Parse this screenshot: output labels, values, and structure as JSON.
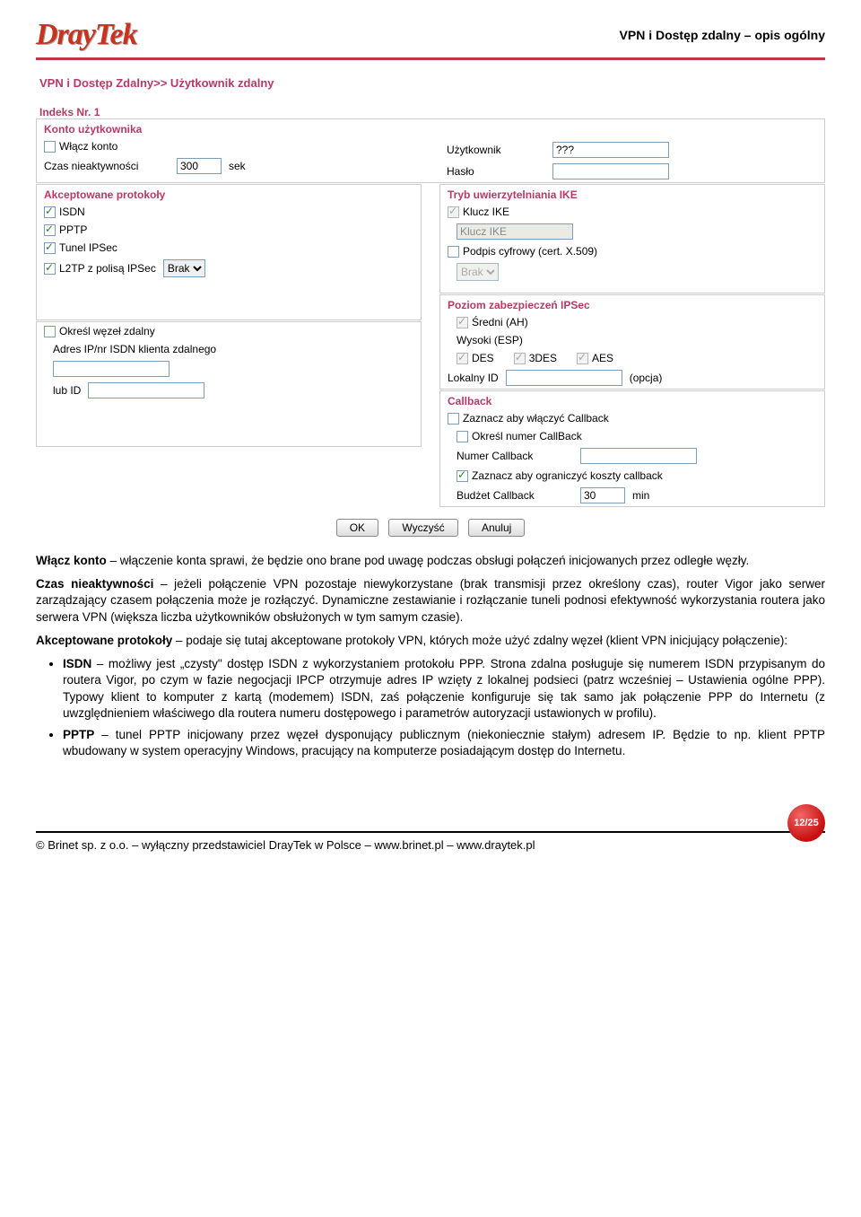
{
  "header": {
    "title": "VPN i Dostęp zdalny – opis ogólny"
  },
  "breadcrumb": "VPN i Dostęp Zdalny>> Użytkownik zdalny",
  "index_label": "Indeks Nr. 1",
  "account": {
    "title": "Konto użytkownika",
    "enable": "Włącz konto",
    "idle_label": "Czas nieaktywności",
    "idle_value": "300",
    "idle_unit": "sek",
    "user_label": "Użytkownik",
    "user_value": "???",
    "pass_label": "Hasło",
    "pass_value": ""
  },
  "protocols": {
    "title": "Akceptowane protokoły",
    "isdn": "ISDN",
    "pptp": "PPTP",
    "ipsec": "Tunel IPSec",
    "l2tp": "L2TP z polisą IPSec",
    "l2tp_select": "Brak",
    "remote_node": "Określ węzeł zdalny",
    "ip_label": "Adres IP/nr ISDN klienta zdalnego",
    "ip_value": "",
    "or_id_label": "lub ID",
    "or_id_value": ""
  },
  "ike": {
    "title": "Tryb uwierzytelniania IKE",
    "key": "Klucz IKE",
    "key_field": "Klucz IKE",
    "cert": "Podpis cyfrowy (cert. X.509)",
    "cert_select": "Brak"
  },
  "ipsec_level": {
    "title": "Poziom zabezpieczeń IPSec",
    "medium": "Średni (AH)",
    "high": "Wysoki (ESP)",
    "des": "DES",
    "tdes": "3DES",
    "aes": "AES",
    "localid": "Lokalny ID",
    "localid_val": "",
    "opt": "(opcja)"
  },
  "callback": {
    "title": "Callback",
    "enable": "Zaznacz aby włączyć Callback",
    "specify": "Określ numer CallBack",
    "num_label": "Numer Callback",
    "num_value": "",
    "limit": "Zaznacz aby ograniczyć koszty callback",
    "budget_label": "Budżet Callback",
    "budget_value": "30",
    "budget_unit": "min"
  },
  "buttons": {
    "ok": "OK",
    "clear": "Wyczyść",
    "cancel": "Anuluj"
  },
  "text": {
    "p1a": "Włącz konto",
    "p1b": " – włączenie konta sprawi, że będzie ono brane pod uwagę podczas obsługi połączeń inicjowanych przez odległe węzły.",
    "p2a": "Czas nieaktywności",
    "p2b": " – jeżeli połączenie VPN pozostaje niewykorzystane (brak transmisji przez określony czas), router Vigor jako serwer zarządzający czasem połączenia może je rozłączyć. Dynamiczne zestawianie i rozłączanie tuneli podnosi efektywność wykorzystania routera jako serwera VPN (większa liczba użytkowników obsłużonych w tym samym czasie).",
    "p3a": "Akceptowane protokoły",
    "p3b": " – podaje się tutaj akceptowane protokoły VPN, których może użyć zdalny węzeł (klient VPN inicjujący połączenie):",
    "li1a": "ISDN",
    "li1b": " – możliwy jest „czysty\" dostęp ISDN z wykorzystaniem protokołu PPP. Strona zdalna posługuje się numerem ISDN przypisanym do routera Vigor, po czym w fazie negocjacji IPCP otrzymuje adres IP wzięty z lokalnej podsieci (patrz wcześniej – Ustawienia ogólne PPP). Typowy klient to komputer z kartą (modemem) ISDN, zaś połączenie konfiguruje się tak samo jak połączenie PPP do Internetu (z uwzględnieniem właściwego dla routera numeru dostępowego i parametrów autoryzacji ustawionych w profilu).",
    "li2a": "PPTP",
    "li2b": " – tunel PPTP inicjowany przez węzeł dysponujący publicznym (niekoniecznie stałym) adresem IP. Będzie to np. klient PPTP wbudowany w system operacyjny Windows, pracujący na komputerze posiadającym dostęp do Internetu."
  },
  "footer": {
    "left": "© Brinet sp. z o.o. – wyłączny przedstawiciel DrayTek w Polsce – www.brinet.pl – www.draytek.pl",
    "page": "12/25"
  }
}
